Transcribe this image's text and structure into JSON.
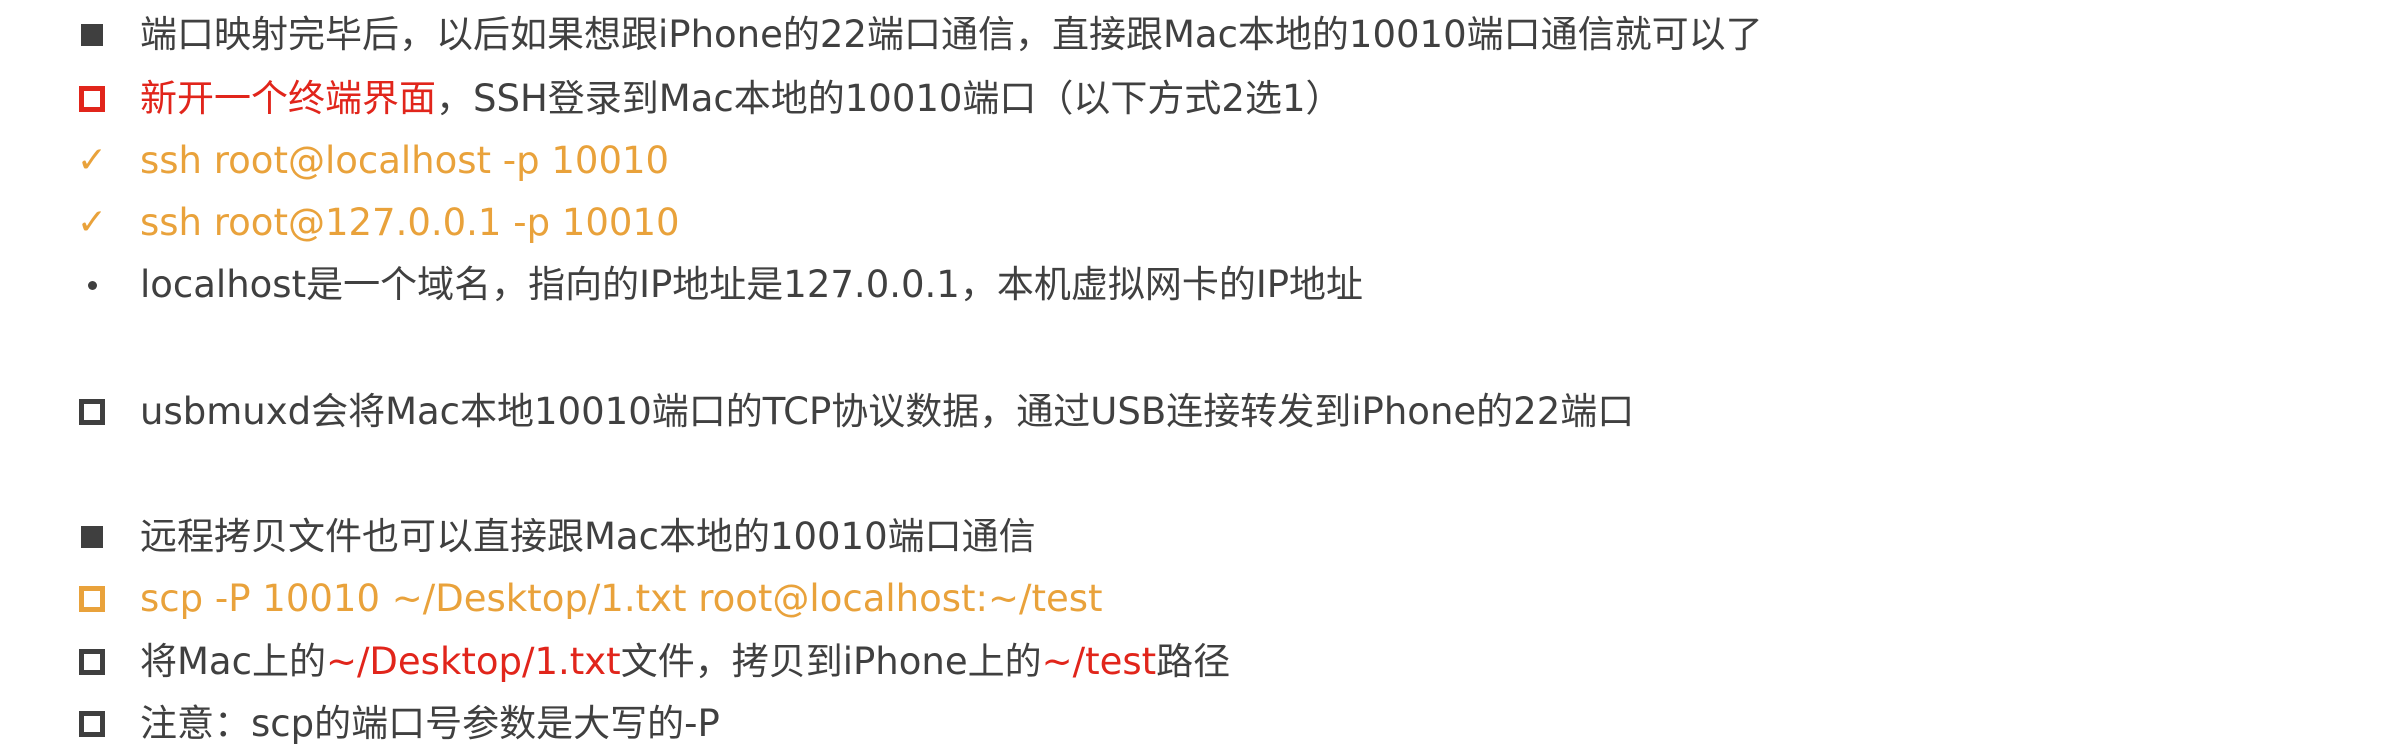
{
  "lines": [
    {
      "bullet": "filled-square",
      "text": "端口映射完毕后，以后如果想跟iPhone的22端口通信，直接跟Mac本地的10010端口通信就可以了"
    },
    {
      "bullet": "hollow-square-red",
      "part1": "新开一个终端界面",
      "part2": "，SSH登录到Mac本地的10010端口（以下方式2选1）"
    },
    {
      "bullet": "check",
      "text": "ssh root@localhost -p 10010"
    },
    {
      "bullet": "check",
      "text": "ssh root@127.0.0.1 -p 10010"
    },
    {
      "bullet": "dot",
      "text": "localhost是一个域名，指向的IP地址是127.0.0.1，本机虚拟网卡的IP地址"
    },
    {
      "bullet": "hollow-square",
      "text": "usbmuxd会将Mac本地10010端口的TCP协议数据，通过USB连接转发到iPhone的22端口"
    },
    {
      "bullet": "filled-square",
      "text": "远程拷贝文件也可以直接跟Mac本地的10010端口通信"
    },
    {
      "bullet": "hollow-square-orange",
      "text": "scp -P 10010 ~/Desktop/1.txt root@localhost:~/test"
    },
    {
      "bullet": "hollow-square",
      "part1": "将Mac上的",
      "part2": "~/Desktop/1.txt",
      "part3": "文件，拷贝到iPhone上的",
      "part4": "~/test",
      "part5": "路径"
    },
    {
      "bullet": "hollow-square",
      "text": "注意：scp的端口号参数是大写的-P"
    }
  ],
  "colors": {
    "text": "#404040",
    "red": "#e1251b",
    "orange": "#e9a23b",
    "bullet": "#3f3f3f"
  },
  "icons": {
    "filled-square": "filled-square-bullet-icon",
    "hollow-square": "hollow-square-bullet-icon",
    "check": "checkmark-icon",
    "dot": "dot-bullet-icon"
  }
}
